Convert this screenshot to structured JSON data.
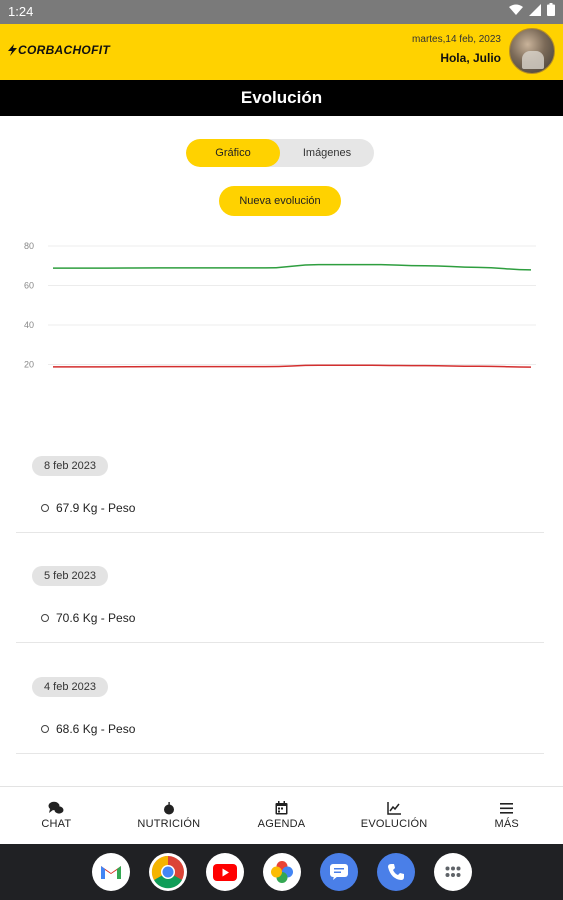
{
  "status": {
    "time": "1:24"
  },
  "header": {
    "brand": "CORBACHOFIT",
    "date": "martes,14 feb, 2023",
    "greeting": "Hola, Julio",
    "accent": "#ffd200"
  },
  "title": "Evolución",
  "tabs": [
    {
      "label": "Gráfico",
      "active": true
    },
    {
      "label": "Imágenes",
      "active": false
    }
  ],
  "new_button": "Nueva evolución",
  "chart_data": {
    "type": "line",
    "x": [
      0,
      1,
      2,
      3,
      4,
      5,
      6,
      7,
      8,
      9
    ],
    "ylim": [
      0,
      80
    ],
    "yticks": [
      "80",
      "60",
      "40",
      "20"
    ],
    "grid": true,
    "series": [
      {
        "color": "#2e9e3f",
        "values": [
          68.8,
          68.8,
          68.9,
          68.9,
          68.9,
          70.6,
          70.6,
          70.0,
          69.2,
          67.9
        ]
      },
      {
        "color": "#d32f2f",
        "values": [
          18.8,
          18.8,
          18.9,
          18.9,
          18.9,
          19.6,
          19.6,
          19.4,
          19.1,
          18.7
        ]
      }
    ]
  },
  "entries": [
    {
      "date": "8 feb 2023",
      "value": "67.9 Kg - Peso"
    },
    {
      "date": "5 feb 2023",
      "value": "70.6 Kg - Peso"
    },
    {
      "date": "4 feb 2023",
      "value": "68.6 Kg - Peso"
    }
  ],
  "nav": [
    {
      "label": "CHAT",
      "icon": "chat-icon"
    },
    {
      "label": "NUTRICIÓN",
      "icon": "apple-icon"
    },
    {
      "label": "AGENDA",
      "icon": "calendar-icon"
    },
    {
      "label": "EVOLUCIÓN",
      "icon": "chart-icon"
    },
    {
      "label": "MÁS",
      "icon": "menu-icon"
    }
  ],
  "dock": [
    "gmail-icon",
    "chrome-icon",
    "youtube-icon",
    "photos-icon",
    "messages-icon",
    "phone-icon",
    "apps-icon"
  ]
}
